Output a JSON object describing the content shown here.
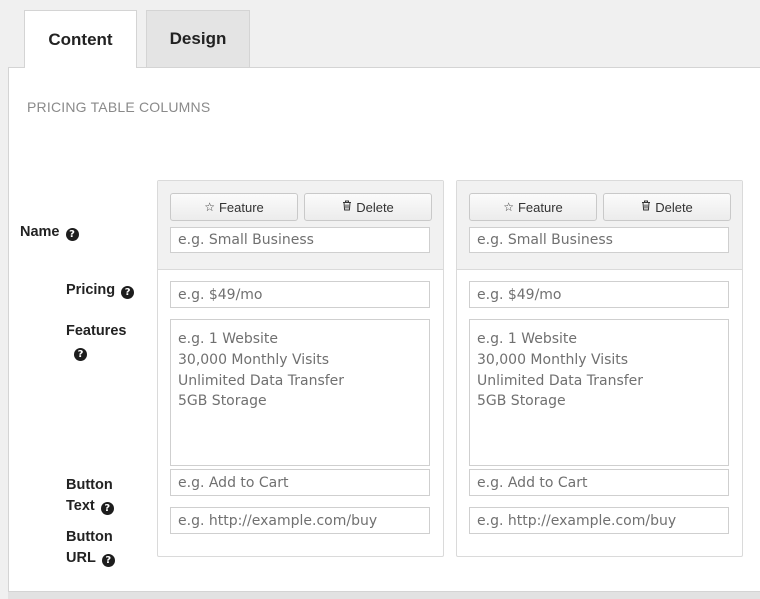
{
  "tabs": [
    {
      "label": "Content",
      "active": true
    },
    {
      "label": "Design",
      "active": false
    }
  ],
  "section_title": "PRICING TABLE COLUMNS",
  "row_labels": {
    "name": "Name",
    "pricing": "Pricing",
    "features": "Features",
    "button_text_line1": "Button",
    "button_text_line2": "Text",
    "button_url_line1": "Button",
    "button_url_line2": "URL"
  },
  "help_icon_glyph": "?",
  "column_buttons": {
    "feature_label": "Feature",
    "feature_icon": "star-outline-icon",
    "delete_label": "Delete",
    "delete_icon": "trash-icon"
  },
  "columns": [
    {
      "name_placeholder": "e.g. Small Business",
      "pricing_placeholder": "e.g. $49/mo",
      "features_placeholder": "e.g. 1 Website\n30,000 Monthly Visits\nUnlimited Data Transfer\n5GB Storage",
      "button_text_placeholder": "e.g. Add to Cart",
      "button_url_placeholder": "e.g. http://example.com/buy"
    },
    {
      "name_placeholder": "e.g. Small Business",
      "pricing_placeholder": "e.g. $49/mo",
      "features_placeholder": "e.g. 1 Website\n30,000 Monthly Visits\nUnlimited Data Transfer\n5GB Storage",
      "button_text_placeholder": "e.g. Add to Cart",
      "button_url_placeholder": "e.g. http://example.com/buy"
    }
  ],
  "colors": {
    "background": "#f0f0f0",
    "panel": "#ffffff",
    "column_header": "#f1f1f1",
    "placeholder_text": "#707070"
  }
}
